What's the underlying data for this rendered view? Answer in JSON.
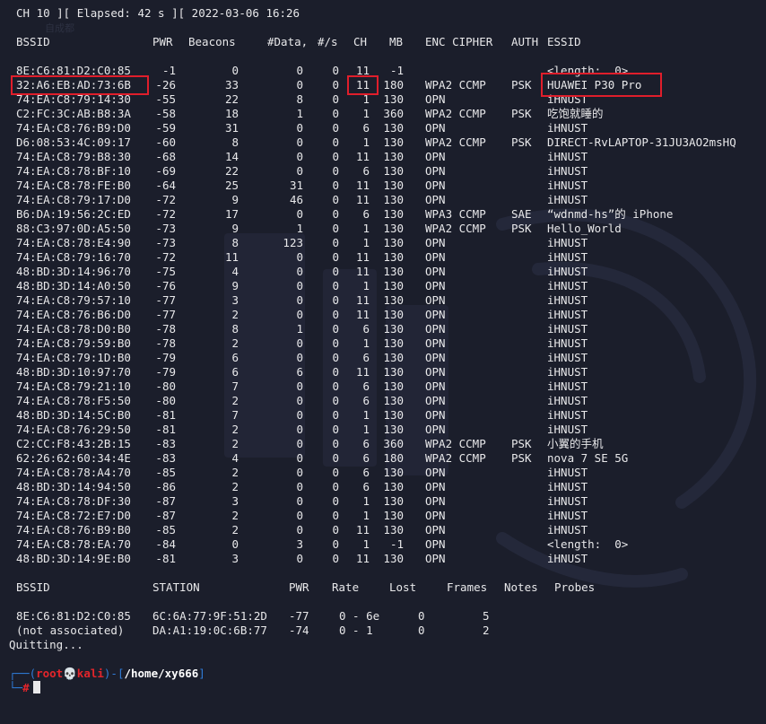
{
  "status_line": "CH 10 ][ Elapsed: 42 s ][ 2022-03-06 16:26",
  "watermark_text": "自成都",
  "ap_headers": {
    "bssid": "BSSID",
    "pwr": "PWR",
    "beacons": "Beacons",
    "data": "#Data,",
    "rate": "#/s",
    "ch": "CH",
    "mb": "MB",
    "enc_cipher": "ENC CIPHER",
    "auth": "AUTH",
    "essid": "ESSID"
  },
  "ap_rows": [
    {
      "bssid": "8E:C6:81:D2:C0:85",
      "pwr": "-1",
      "beacons": "0",
      "data": "0",
      "rate": "0",
      "ch": "11",
      "mb": "-1",
      "enc": "",
      "auth": "",
      "essid": "<length:  0>"
    },
    {
      "bssid": "32:A6:EB:AD:73:6B",
      "pwr": "-26",
      "beacons": "33",
      "data": "0",
      "rate": "0",
      "ch": "11",
      "mb": "180",
      "enc": "WPA2 CCMP",
      "auth": "PSK",
      "essid": "HUAWEI P30 Pro"
    },
    {
      "bssid": "74:EA:C8:79:14:30",
      "pwr": "-55",
      "beacons": "22",
      "data": "8",
      "rate": "0",
      "ch": "1",
      "mb": "130",
      "enc": "OPN",
      "auth": "",
      "essid": "iHNUST"
    },
    {
      "bssid": "C2:FC:3C:AB:B8:3A",
      "pwr": "-58",
      "beacons": "18",
      "data": "1",
      "rate": "0",
      "ch": "1",
      "mb": "360",
      "enc": "WPA2 CCMP",
      "auth": "PSK",
      "essid": "吃饱就睡的"
    },
    {
      "bssid": "74:EA:C8:76:B9:D0",
      "pwr": "-59",
      "beacons": "31",
      "data": "0",
      "rate": "0",
      "ch": "6",
      "mb": "130",
      "enc": "OPN",
      "auth": "",
      "essid": "iHNUST"
    },
    {
      "bssid": "D6:08:53:4C:09:17",
      "pwr": "-60",
      "beacons": "8",
      "data": "0",
      "rate": "0",
      "ch": "1",
      "mb": "130",
      "enc": "WPA2 CCMP",
      "auth": "PSK",
      "essid": "DIRECT-RvLAPTOP-31JU3AO2msHQ"
    },
    {
      "bssid": "74:EA:C8:79:B8:30",
      "pwr": "-68",
      "beacons": "14",
      "data": "0",
      "rate": "0",
      "ch": "11",
      "mb": "130",
      "enc": "OPN",
      "auth": "",
      "essid": "iHNUST"
    },
    {
      "bssid": "74:EA:C8:78:BF:10",
      "pwr": "-69",
      "beacons": "22",
      "data": "0",
      "rate": "0",
      "ch": "6",
      "mb": "130",
      "enc": "OPN",
      "auth": "",
      "essid": "iHNUST"
    },
    {
      "bssid": "74:EA:C8:78:FE:B0",
      "pwr": "-64",
      "beacons": "25",
      "data": "31",
      "rate": "0",
      "ch": "11",
      "mb": "130",
      "enc": "OPN",
      "auth": "",
      "essid": "iHNUST"
    },
    {
      "bssid": "74:EA:C8:79:17:D0",
      "pwr": "-72",
      "beacons": "9",
      "data": "46",
      "rate": "0",
      "ch": "11",
      "mb": "130",
      "enc": "OPN",
      "auth": "",
      "essid": "iHNUST"
    },
    {
      "bssid": "B6:DA:19:56:2C:ED",
      "pwr": "-72",
      "beacons": "17",
      "data": "0",
      "rate": "0",
      "ch": "6",
      "mb": "130",
      "enc": "WPA3 CCMP",
      "auth": "SAE",
      "essid": "“wdnmd-hs”的 iPhone"
    },
    {
      "bssid": "88:C3:97:0D:A5:50",
      "pwr": "-73",
      "beacons": "9",
      "data": "1",
      "rate": "0",
      "ch": "1",
      "mb": "130",
      "enc": "WPA2 CCMP",
      "auth": "PSK",
      "essid": "Hello_World"
    },
    {
      "bssid": "74:EA:C8:78:E4:90",
      "pwr": "-73",
      "beacons": "8",
      "data": "123",
      "rate": "0",
      "ch": "1",
      "mb": "130",
      "enc": "OPN",
      "auth": "",
      "essid": "iHNUST"
    },
    {
      "bssid": "74:EA:C8:79:16:70",
      "pwr": "-72",
      "beacons": "11",
      "data": "0",
      "rate": "0",
      "ch": "11",
      "mb": "130",
      "enc": "OPN",
      "auth": "",
      "essid": "iHNUST"
    },
    {
      "bssid": "48:BD:3D:14:96:70",
      "pwr": "-75",
      "beacons": "4",
      "data": "0",
      "rate": "0",
      "ch": "11",
      "mb": "130",
      "enc": "OPN",
      "auth": "",
      "essid": "iHNUST"
    },
    {
      "bssid": "48:BD:3D:14:A0:50",
      "pwr": "-76",
      "beacons": "9",
      "data": "0",
      "rate": "0",
      "ch": "1",
      "mb": "130",
      "enc": "OPN",
      "auth": "",
      "essid": "iHNUST"
    },
    {
      "bssid": "74:EA:C8:79:57:10",
      "pwr": "-77",
      "beacons": "3",
      "data": "0",
      "rate": "0",
      "ch": "11",
      "mb": "130",
      "enc": "OPN",
      "auth": "",
      "essid": "iHNUST"
    },
    {
      "bssid": "74:EA:C8:76:B6:D0",
      "pwr": "-77",
      "beacons": "2",
      "data": "0",
      "rate": "0",
      "ch": "11",
      "mb": "130",
      "enc": "OPN",
      "auth": "",
      "essid": "iHNUST"
    },
    {
      "bssid": "74:EA:C8:78:D0:B0",
      "pwr": "-78",
      "beacons": "8",
      "data": "1",
      "rate": "0",
      "ch": "6",
      "mb": "130",
      "enc": "OPN",
      "auth": "",
      "essid": "iHNUST"
    },
    {
      "bssid": "74:EA:C8:79:59:B0",
      "pwr": "-78",
      "beacons": "2",
      "data": "0",
      "rate": "0",
      "ch": "1",
      "mb": "130",
      "enc": "OPN",
      "auth": "",
      "essid": "iHNUST"
    },
    {
      "bssid": "74:EA:C8:79:1D:B0",
      "pwr": "-79",
      "beacons": "6",
      "data": "0",
      "rate": "0",
      "ch": "6",
      "mb": "130",
      "enc": "OPN",
      "auth": "",
      "essid": "iHNUST"
    },
    {
      "bssid": "48:BD:3D:10:97:70",
      "pwr": "-79",
      "beacons": "6",
      "data": "6",
      "rate": "0",
      "ch": "11",
      "mb": "130",
      "enc": "OPN",
      "auth": "",
      "essid": "iHNUST"
    },
    {
      "bssid": "74:EA:C8:79:21:10",
      "pwr": "-80",
      "beacons": "7",
      "data": "0",
      "rate": "0",
      "ch": "6",
      "mb": "130",
      "enc": "OPN",
      "auth": "",
      "essid": "iHNUST"
    },
    {
      "bssid": "74:EA:C8:78:F5:50",
      "pwr": "-80",
      "beacons": "2",
      "data": "0",
      "rate": "0",
      "ch": "6",
      "mb": "130",
      "enc": "OPN",
      "auth": "",
      "essid": "iHNUST"
    },
    {
      "bssid": "48:BD:3D:14:5C:B0",
      "pwr": "-81",
      "beacons": "7",
      "data": "0",
      "rate": "0",
      "ch": "1",
      "mb": "130",
      "enc": "OPN",
      "auth": "",
      "essid": "iHNUST"
    },
    {
      "bssid": "74:EA:C8:76:29:50",
      "pwr": "-81",
      "beacons": "2",
      "data": "0",
      "rate": "0",
      "ch": "1",
      "mb": "130",
      "enc": "OPN",
      "auth": "",
      "essid": "iHNUST"
    },
    {
      "bssid": "C2:CC:F8:43:2B:15",
      "pwr": "-83",
      "beacons": "2",
      "data": "0",
      "rate": "0",
      "ch": "6",
      "mb": "360",
      "enc": "WPA2 CCMP",
      "auth": "PSK",
      "essid": "小翼的手机"
    },
    {
      "bssid": "62:26:62:60:34:4E",
      "pwr": "-83",
      "beacons": "4",
      "data": "0",
      "rate": "0",
      "ch": "6",
      "mb": "180",
      "enc": "WPA2 CCMP",
      "auth": "PSK",
      "essid": "nova 7 SE 5G"
    },
    {
      "bssid": "74:EA:C8:78:A4:70",
      "pwr": "-85",
      "beacons": "2",
      "data": "0",
      "rate": "0",
      "ch": "6",
      "mb": "130",
      "enc": "OPN",
      "auth": "",
      "essid": "iHNUST"
    },
    {
      "bssid": "48:BD:3D:14:94:50",
      "pwr": "-86",
      "beacons": "2",
      "data": "0",
      "rate": "0",
      "ch": "6",
      "mb": "130",
      "enc": "OPN",
      "auth": "",
      "essid": "iHNUST"
    },
    {
      "bssid": "74:EA:C8:78:DF:30",
      "pwr": "-87",
      "beacons": "3",
      "data": "0",
      "rate": "0",
      "ch": "1",
      "mb": "130",
      "enc": "OPN",
      "auth": "",
      "essid": "iHNUST"
    },
    {
      "bssid": "74:EA:C8:72:E7:D0",
      "pwr": "-87",
      "beacons": "2",
      "data": "0",
      "rate": "0",
      "ch": "1",
      "mb": "130",
      "enc": "OPN",
      "auth": "",
      "essid": "iHNUST"
    },
    {
      "bssid": "74:EA:C8:76:B9:B0",
      "pwr": "-85",
      "beacons": "2",
      "data": "0",
      "rate": "0",
      "ch": "11",
      "mb": "130",
      "enc": "OPN",
      "auth": "",
      "essid": "iHNUST"
    },
    {
      "bssid": "74:EA:C8:78:EA:70",
      "pwr": "-84",
      "beacons": "0",
      "data": "3",
      "rate": "0",
      "ch": "1",
      "mb": "-1",
      "enc": "OPN",
      "auth": "",
      "essid": "<length:  0>"
    },
    {
      "bssid": "48:BD:3D:14:9E:B0",
      "pwr": "-81",
      "beacons": "3",
      "data": "0",
      "rate": "0",
      "ch": "11",
      "mb": "130",
      "enc": "OPN",
      "auth": "",
      "essid": "iHNUST"
    }
  ],
  "sta_headers": {
    "bssid": "BSSID",
    "station": "STATION",
    "pwr": "PWR",
    "rate": "Rate",
    "lost": "Lost",
    "frames": "Frames",
    "notes": "Notes",
    "probes": "Probes"
  },
  "sta_rows": [
    {
      "bssid": "8E:C6:81:D2:C0:85",
      "station": "6C:6A:77:9F:51:2D",
      "pwr": "-77",
      "rate": "0 - 6e",
      "lost": "0",
      "frames": "5"
    },
    {
      "bssid": "(not associated)",
      "station": "DA:A1:19:0C:6B:77",
      "pwr": "-74",
      "rate": "0 - 1",
      "lost": "0",
      "frames": "2"
    }
  ],
  "quitting": "Quitting...",
  "prompt": {
    "open_frame": "┌──(",
    "user": "root",
    "skull": "💀",
    "host": "kali",
    "mid_frame": ")-[",
    "path": "/home/xy666",
    "close_frame": "]",
    "second_frame": "└─",
    "symbol": "#"
  },
  "highlight_color": "#e01e2b",
  "colors": {
    "background": "#1b1e2b",
    "text": "#e8e8ea",
    "prompt_blue": "#2f7cd9",
    "prompt_red": "#e3252b"
  }
}
